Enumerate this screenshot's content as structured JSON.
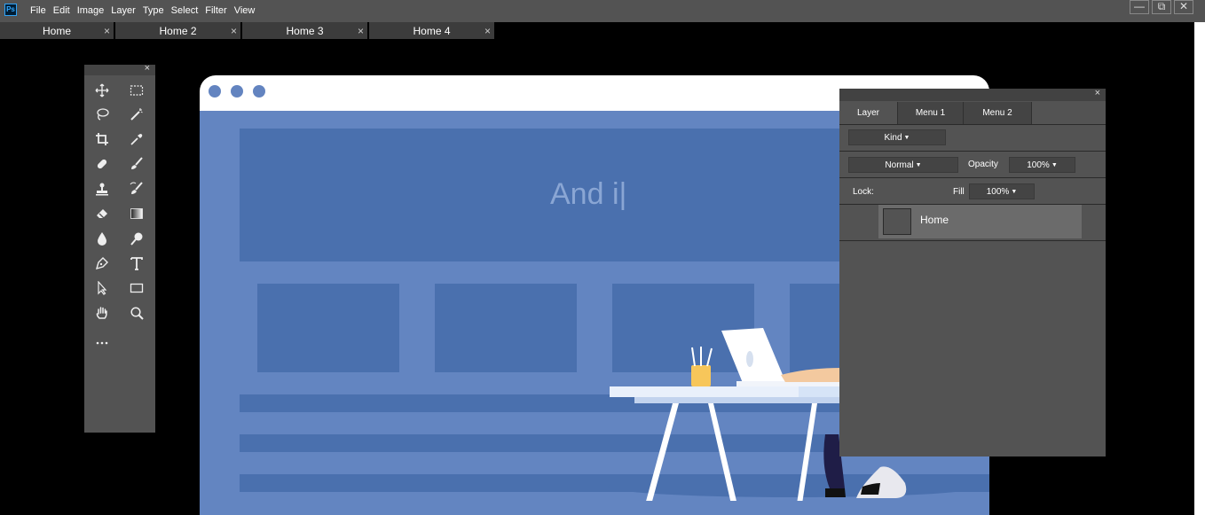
{
  "app": {
    "logo": "Ps"
  },
  "menu": [
    "File",
    "Edit",
    "Image",
    "Layer",
    "Type",
    "Select",
    "Filter",
    "View"
  ],
  "window_controls": [
    "minimize-icon",
    "restore-icon",
    "close-icon"
  ],
  "tabs": [
    {
      "label": "Home",
      "close": "×"
    },
    {
      "label": "Home 2",
      "close": "×"
    },
    {
      "label": "Home 3",
      "close": "×"
    },
    {
      "label": "Home 4",
      "close": "×"
    }
  ],
  "toolbox": {
    "close": "×",
    "tools": [
      "move-icon",
      "marquee-icon",
      "lasso-icon",
      "magic-wand-icon",
      "crop-icon",
      "eyedropper-icon",
      "healing-icon",
      "brush-icon",
      "stamp-icon",
      "history-brush-icon",
      "eraser-icon",
      "gradient-icon",
      "blur-icon",
      "dodge-icon",
      "pen-icon",
      "type-icon",
      "path-select-icon",
      "rectangle-icon",
      "hand-icon",
      "zoom-icon",
      "more-icon"
    ]
  },
  "canvas": {
    "hero_text": "And i|"
  },
  "layers_panel": {
    "close": "×",
    "tabs": [
      "Layer",
      "Menu 1",
      "Menu 2"
    ],
    "kind_label": "Kind",
    "blend_mode": "Normal",
    "opacity_label": "Opacity",
    "opacity_value": "100%",
    "lock_label": "Lock:",
    "fill_label": "Fill",
    "fill_value": "100%",
    "layers": [
      {
        "name": "Home"
      }
    ]
  },
  "colors": {
    "chrome": "#535353",
    "canvas_blue": "#6385c1",
    "canvas_dark_blue": "#4a70ae"
  }
}
